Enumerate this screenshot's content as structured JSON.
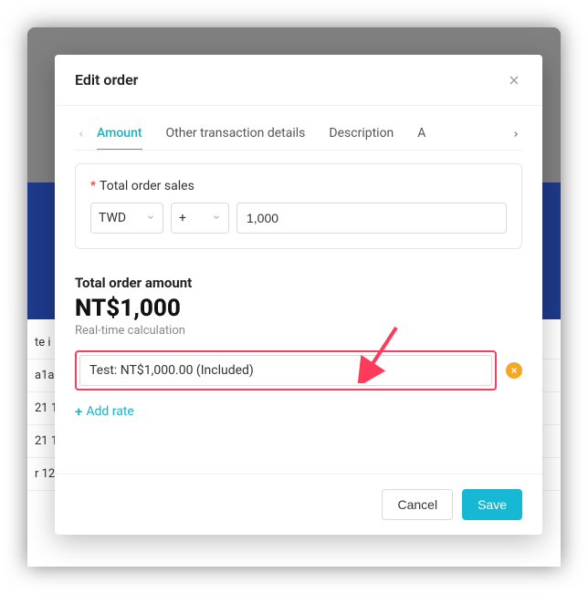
{
  "modal": {
    "title": "Edit order",
    "tabs": [
      {
        "label": "Amount",
        "active": true
      },
      {
        "label": "Other transaction details",
        "active": false
      },
      {
        "label": "Description",
        "active": false
      },
      {
        "label": "A",
        "active": false
      }
    ],
    "total_sales": {
      "label": "Total order sales",
      "currency": "TWD",
      "sign": "+",
      "value": "1,000"
    },
    "total_amount": {
      "label": "Total order amount",
      "value": "NT$1,000",
      "subtext": "Real-time calculation"
    },
    "rate_select": "Test: NT$1,000.00 (Included)",
    "add_rate": "Add rate",
    "footer": {
      "cancel": "Cancel",
      "save": "Save"
    }
  },
  "background": {
    "rows": [
      "te i",
      "a1a",
      "21 1",
      "21 1",
      "r 12"
    ]
  },
  "colors": {
    "accent": "#12b7c6",
    "danger": "#ff3b5c",
    "warn": "#f5a623"
  }
}
